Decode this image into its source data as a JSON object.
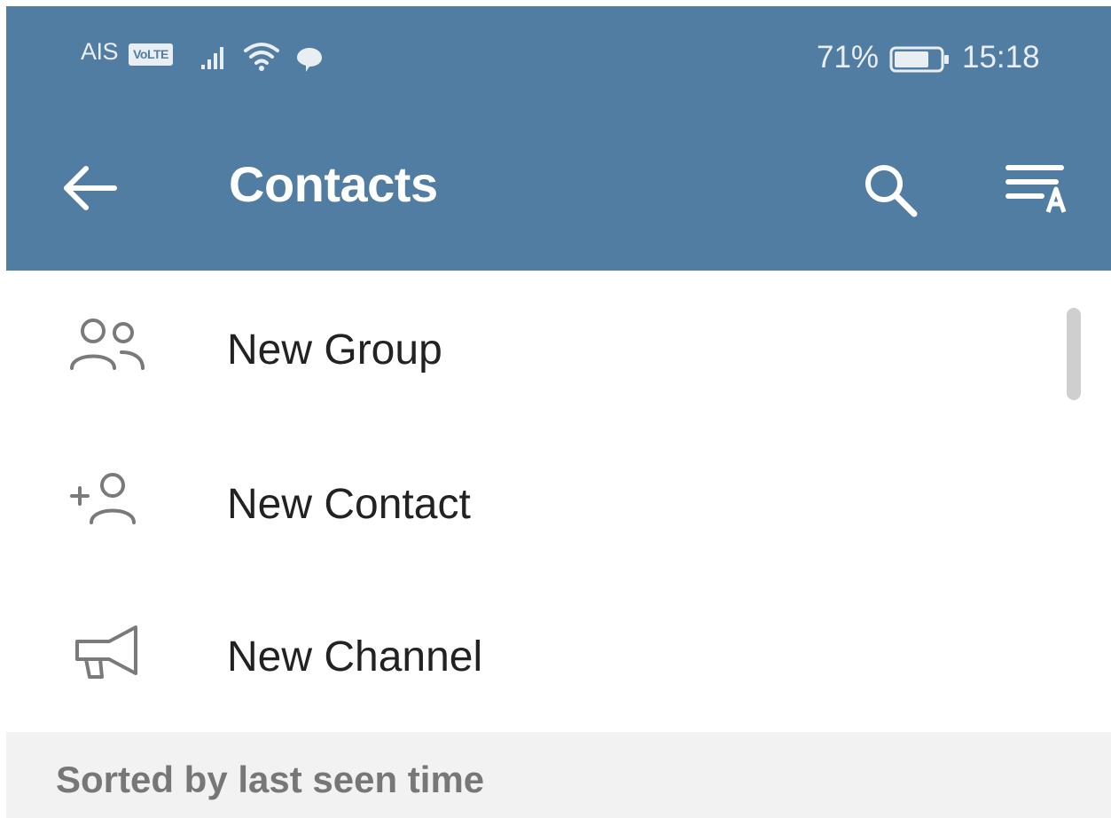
{
  "status_bar": {
    "carrier": "AIS",
    "volte": "VoLTE",
    "battery_percent": "71%",
    "time": "15:18"
  },
  "app_bar": {
    "title": "Contacts",
    "back_icon": "arrow-left-icon",
    "search_icon": "search-icon",
    "sort_icon": "sort-alphabet-icon",
    "background_color": "#517da2"
  },
  "actions": [
    {
      "label": "New Group",
      "icon": "group-icon"
    },
    {
      "label": "New Contact",
      "icon": "add-contact-icon"
    },
    {
      "label": "New Channel",
      "icon": "megaphone-icon"
    }
  ],
  "section_header": {
    "label": "Sorted by last seen time"
  }
}
